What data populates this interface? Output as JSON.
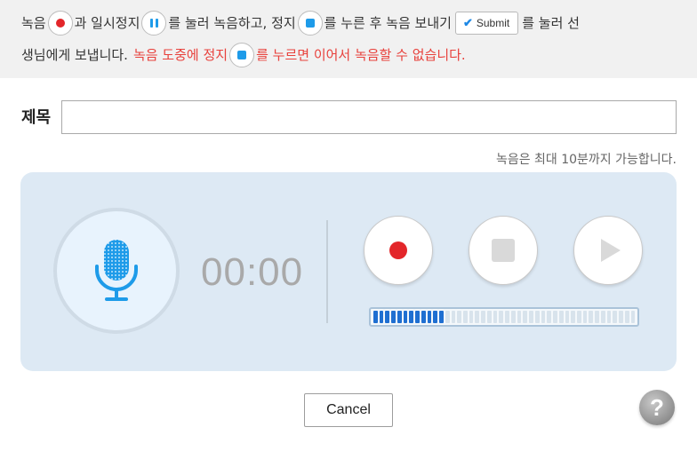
{
  "notice": {
    "l1_a": "녹음",
    "l1_b": "과 일시정지",
    "l1_c": "를 눌러 녹음하고, 정지",
    "l1_d": "를 누른 후 녹음 보내기",
    "submit_label": "Submit",
    "l1_e": "를 눌러 선",
    "l2_a": "생님에게 보냅니다.",
    "l2_warn_a": "녹음 도중에 정지",
    "l2_warn_b": "를 누르면 이어서 녹음할 수 없습니다."
  },
  "form": {
    "title_label": "제목",
    "title_value": "",
    "limit_text": "녹음은 최대 10분까지 가능합니다."
  },
  "recorder": {
    "timer": "00:00",
    "level_fraction": 0.27,
    "colors": {
      "record": "#e3262a",
      "accent": "#1e9be9",
      "panel": "#dde9f4"
    }
  },
  "icons": {
    "mic": "microphone-icon",
    "record": "record-icon",
    "stop": "stop-icon",
    "play": "play-icon",
    "pause": "pause-icon",
    "check": "checkmark-icon",
    "help": "question-icon"
  },
  "footer": {
    "cancel_label": "Cancel",
    "help_label": "?"
  }
}
